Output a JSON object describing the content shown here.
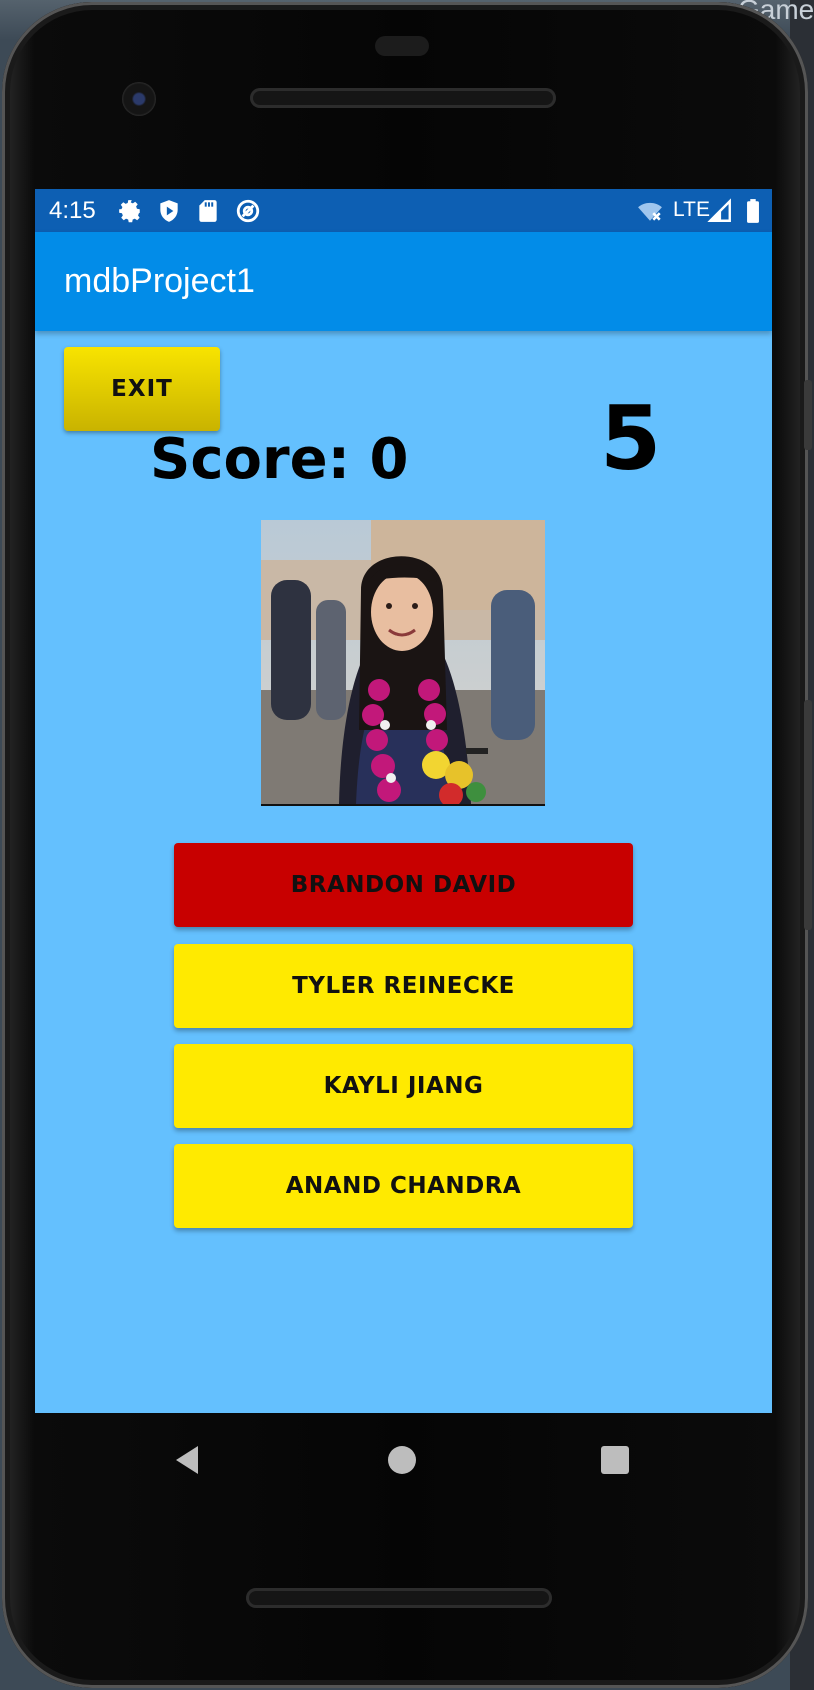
{
  "ide": {
    "tab_label": "Game"
  },
  "status_bar": {
    "time": "4:15",
    "network": "LTE",
    "left_icons": [
      "gear-icon",
      "shield-icon",
      "sd-card-icon",
      "at-sign-icon"
    ],
    "right_icons": [
      "wifi-off-icon",
      "signal-icon",
      "battery-icon"
    ]
  },
  "app_bar": {
    "title": "mdbProject1"
  },
  "game": {
    "exit_label": "EXIT",
    "score_text": "Score: 0",
    "countdown": "5",
    "choices": [
      {
        "label": "BRANDON DAVID",
        "state": "wrong"
      },
      {
        "label": "TYLER REINECKE",
        "state": "default"
      },
      {
        "label": "KAYLI JIANG",
        "state": "default"
      },
      {
        "label": "ANAND CHANDRA",
        "state": "default"
      }
    ]
  },
  "colors": {
    "screen_bg": "#64c0fe",
    "status_bar": "#0d5fb3",
    "app_bar": "#028ce8",
    "choice_default": "#ffea00",
    "choice_wrong": "#c80000"
  },
  "nav_bar": {
    "buttons": [
      "back-icon",
      "home-icon",
      "recents-icon"
    ]
  }
}
